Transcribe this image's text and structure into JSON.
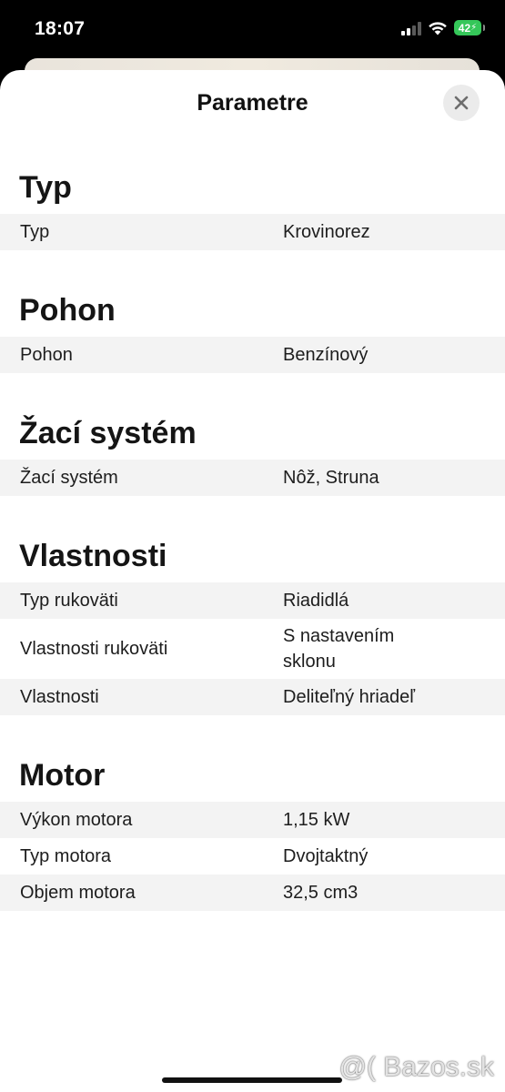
{
  "status_bar": {
    "time": "18:07",
    "battery_level": "42",
    "icons": [
      "signal-icon",
      "wifi-icon",
      "battery-charging-icon"
    ]
  },
  "sheet": {
    "title": "Parametre",
    "close_icon": "close-icon"
  },
  "sections": [
    {
      "heading": "Typ",
      "rows": [
        {
          "label": "Typ",
          "value": "Krovinorez"
        }
      ]
    },
    {
      "heading": "Pohon",
      "rows": [
        {
          "label": "Pohon",
          "value": "Benzínový"
        }
      ]
    },
    {
      "heading": "Žací systém",
      "rows": [
        {
          "label": "Žací systém",
          "value": "Nôž, Struna"
        }
      ]
    },
    {
      "heading": "Vlastnosti",
      "rows": [
        {
          "label": "Typ rukoväti",
          "value": "Riadidlá"
        },
        {
          "label": "Vlastnosti rukoväti",
          "value": "S nastavením sklonu"
        },
        {
          "label": "Vlastnosti",
          "value": "Deliteľný hriadeľ"
        }
      ]
    },
    {
      "heading": "Motor",
      "rows": [
        {
          "label": "Výkon motora",
          "value": "1,15 kW"
        },
        {
          "label": "Typ motora",
          "value": "Dvojtaktný"
        },
        {
          "label": "Objem motora",
          "value": "32,5 cm3"
        }
      ]
    }
  ],
  "watermark": "@( Bazos.sk",
  "colors": {
    "battery": "#35c759",
    "row_shade": "#f3f3f3",
    "sheet_background": "#ffffff"
  }
}
